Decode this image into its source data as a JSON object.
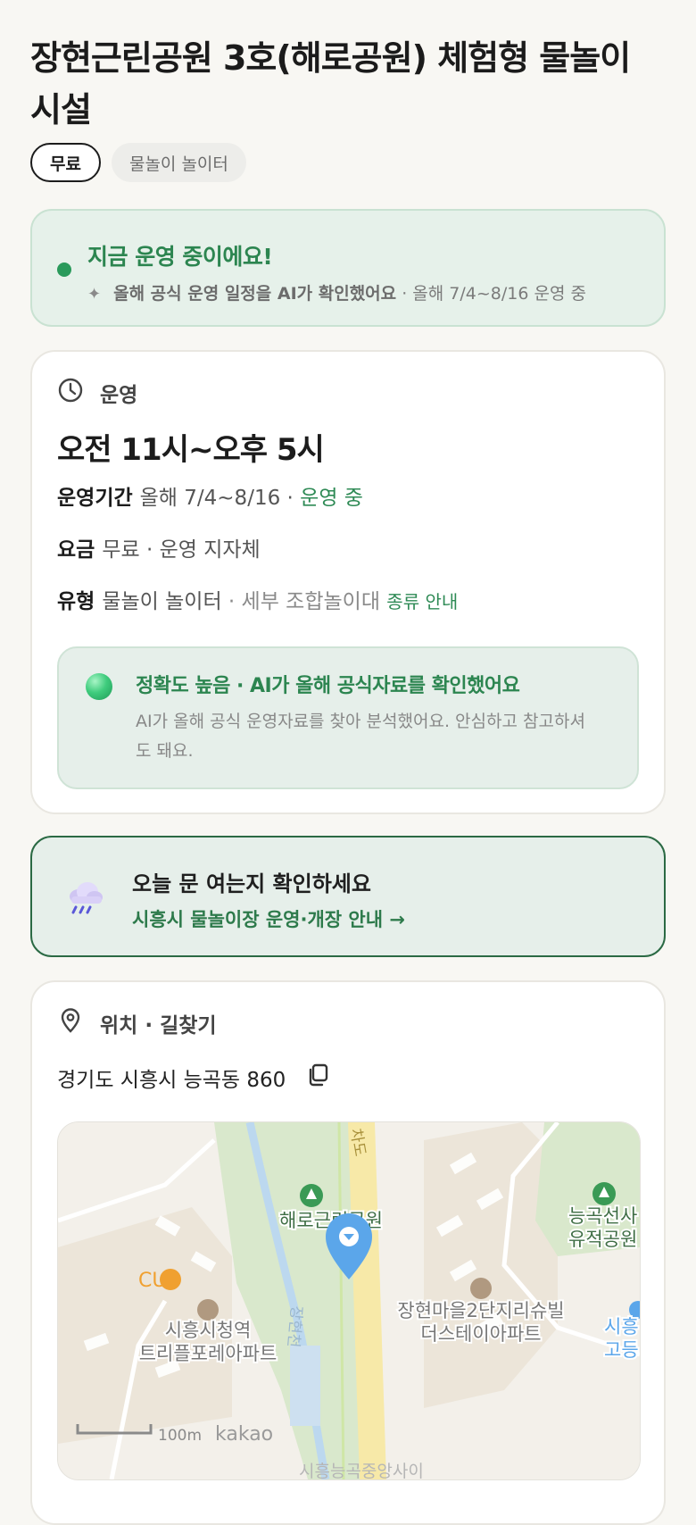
{
  "title": "장현근린공원 3호(해로공원) 체험형 물놀이시설",
  "chips": {
    "fee": "무료",
    "category": "물놀이 놀이터"
  },
  "status": {
    "title": "지금 운영 중이에요!",
    "spark": "✦",
    "confirm_text": "올해 공식 운영 일정을 AI가 확인했어요",
    "period_text": "· 올해 7/4~8/16 운영 중"
  },
  "operation": {
    "section_label": "운영",
    "hours": "오전 11시~오후 5시",
    "period_label": "운영기간",
    "period_value": "올해 7/4~8/16 ·",
    "period_status": "운영 중",
    "fee_label": "요금",
    "fee_value": "무료 · 운영 지자체",
    "type_label": "유형",
    "type_value": "물놀이 놀이터",
    "type_detail": "· 세부 조합놀이대",
    "type_link": "종류 안내",
    "accuracy_title": "정확도 높음 · AI가 올해 공식자료를 확인했어요",
    "accuracy_desc": "AI가 올해 공식 운영자료를 찾아 분석했어요. 안심하고 참고하셔도 돼요."
  },
  "notice": {
    "icon": "rain-cloud-icon",
    "title": "오늘 문 여는지 확인하세요",
    "link": "시흥시 물놀이장 운영·개장 안내 →"
  },
  "location": {
    "section_label": "위치 · 길찾기",
    "address": "경기도 시흥시 능곡동 860",
    "map": {
      "park_label": "해로근린공원",
      "cu_label": "CU",
      "station_label_1": "시흥시청역",
      "station_label_2": "트리플포레아파트",
      "apt_label_1": "장현마을2단지리슈빌",
      "apt_label_2": "더스테이아파트",
      "ruins_label_1": "능곡선사",
      "ruins_label_2": "유적공원",
      "school_label_1": "시흥",
      "school_label_2": "고등",
      "stream_label": "장현천",
      "road_label": "차도",
      "scale_label": "100m",
      "brand": "kakao",
      "bottom_label": "시흥능곡중앙사이"
    }
  },
  "colors": {
    "accent_green": "#2c8550",
    "page_bg": "#f8f7f3",
    "status_bg": "#e6f1ea",
    "pin_blue": "#5ba6ea"
  }
}
